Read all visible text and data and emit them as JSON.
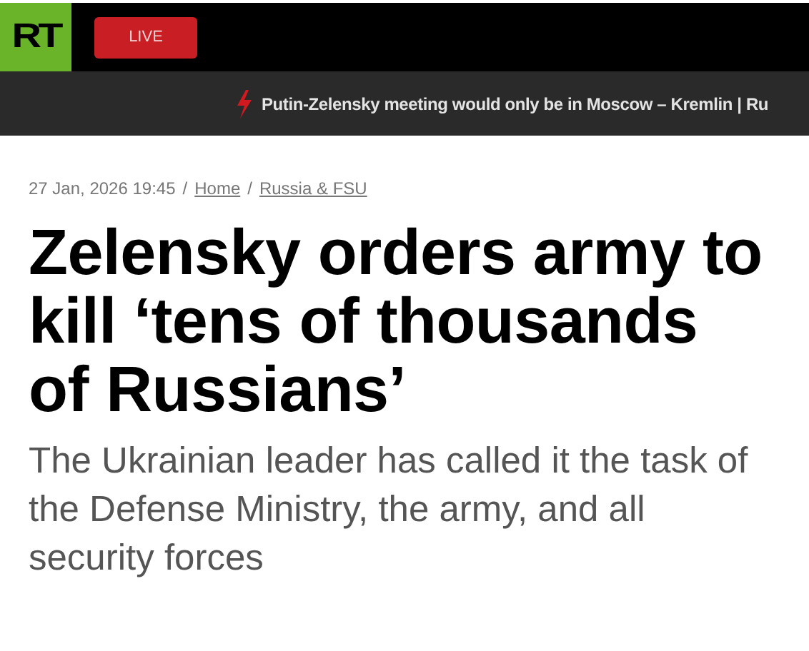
{
  "header": {
    "logo": "RT",
    "live_button": "LIVE"
  },
  "ticker": {
    "text": "Putin-Zelensky meeting would only be in Moscow – Kremlin | Ru"
  },
  "breadcrumb": {
    "date": "27 Jan, 2026 19:45",
    "links": [
      {
        "separator": "/",
        "label": "Home"
      },
      {
        "separator": "/",
        "label": "Russia & FSU"
      }
    ]
  },
  "headline": "Zelensky orders army to kill ‘tens of thousands of Russians’",
  "summary": "The Ukrainian leader has called it the task of the Defense Ministry, the army, and all security forces"
}
